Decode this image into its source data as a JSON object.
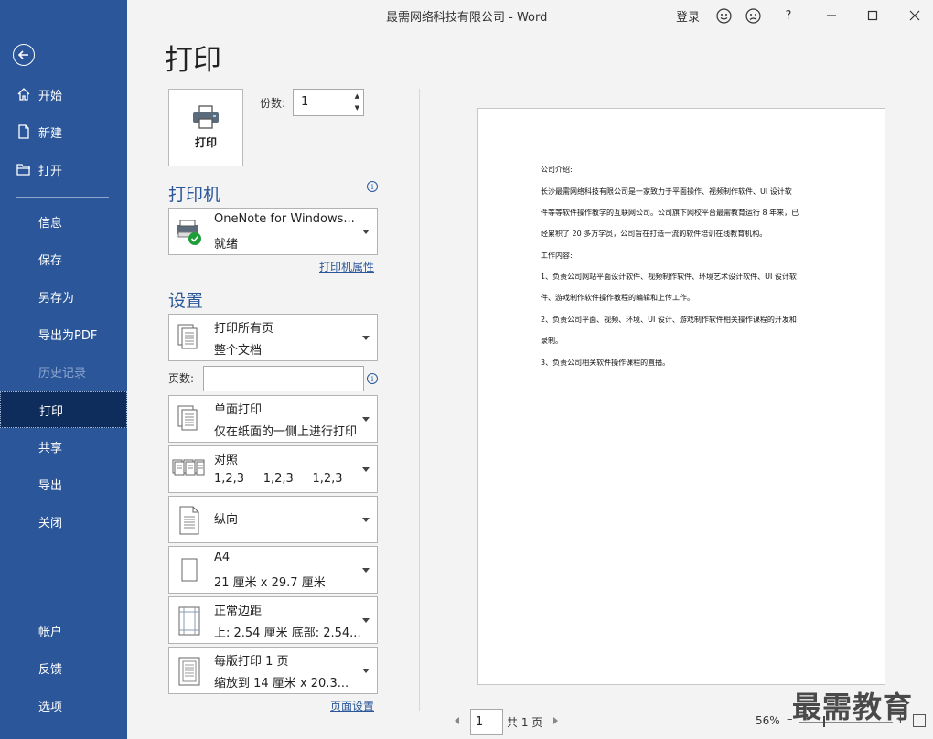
{
  "window": {
    "title": "最需网络科技有限公司  -  Word",
    "sign_in": "登录",
    "help": "?"
  },
  "sidebar": {
    "items": [
      {
        "label": "开始",
        "icon": "home-icon"
      },
      {
        "label": "新建",
        "icon": "new-document-icon"
      },
      {
        "label": "打开",
        "icon": "open-folder-icon"
      },
      {
        "label": "信息"
      },
      {
        "label": "保存"
      },
      {
        "label": "另存为"
      },
      {
        "label": "导出为PDF"
      },
      {
        "label": "历史记录",
        "disabled": true
      },
      {
        "label": "打印",
        "active": true
      },
      {
        "label": "共享"
      },
      {
        "label": "导出"
      },
      {
        "label": "关闭"
      },
      {
        "label": "帐户"
      },
      {
        "label": "反馈"
      },
      {
        "label": "选项"
      }
    ]
  },
  "print": {
    "title": "打印",
    "print_button": "打印",
    "copies_label": "份数:",
    "copies_value": "1",
    "printer_section": "打印机",
    "printer_name": "OneNote for Windows...",
    "printer_status": "就绪",
    "printer_properties": "打印机属性",
    "settings_section": "设置",
    "range_main": "打印所有页",
    "range_sub": "整个文档",
    "pages_label": "页数:",
    "pages_value": "",
    "sides_main": "单面打印",
    "sides_sub": "仅在纸面的一侧上进行打印",
    "collate_main": "对照",
    "collate_sub": "1,2,3     1,2,3     1,2,3",
    "orientation_main": "纵向",
    "paper_main": "A4",
    "paper_sub": "21 厘米 x 29.7 厘米",
    "margins_main": "正常边距",
    "margins_sub": "上: 2.54 厘米 底部: 2.54...",
    "per_sheet_main": "每版打印 1 页",
    "per_sheet_sub": "缩放到 14 厘米 x 20.3...",
    "page_setup": "页面设置"
  },
  "preview": {
    "lines": [
      "公司介绍:",
      "长沙最需网络科技有限公司是一家致力于平面操作、视频制作软件、UI 设计软",
      "件等等软件操作教学的互联网公司。公司旗下网校平台最需教育运行 8 年来，已",
      "经累积了 20 多万学员，公司旨在打造一流的软件培训在线教育机构。",
      "工作内容:",
      "1、负责公司网站平面设计软件、视频制作软件、环境艺术设计软件、UI 设计软",
      "件、游戏制作软件操作教程的编辑和上传工作。",
      "2、负责公司平面、视频、环境、UI 设计、游戏制作软件相关操作课程的开发和",
      "录制。",
      "3、负责公司相关软件操作课程的直播。"
    ],
    "current_page": "1",
    "total_pages": "共 1 页",
    "zoom": "56%"
  },
  "watermark": "最需教育"
}
